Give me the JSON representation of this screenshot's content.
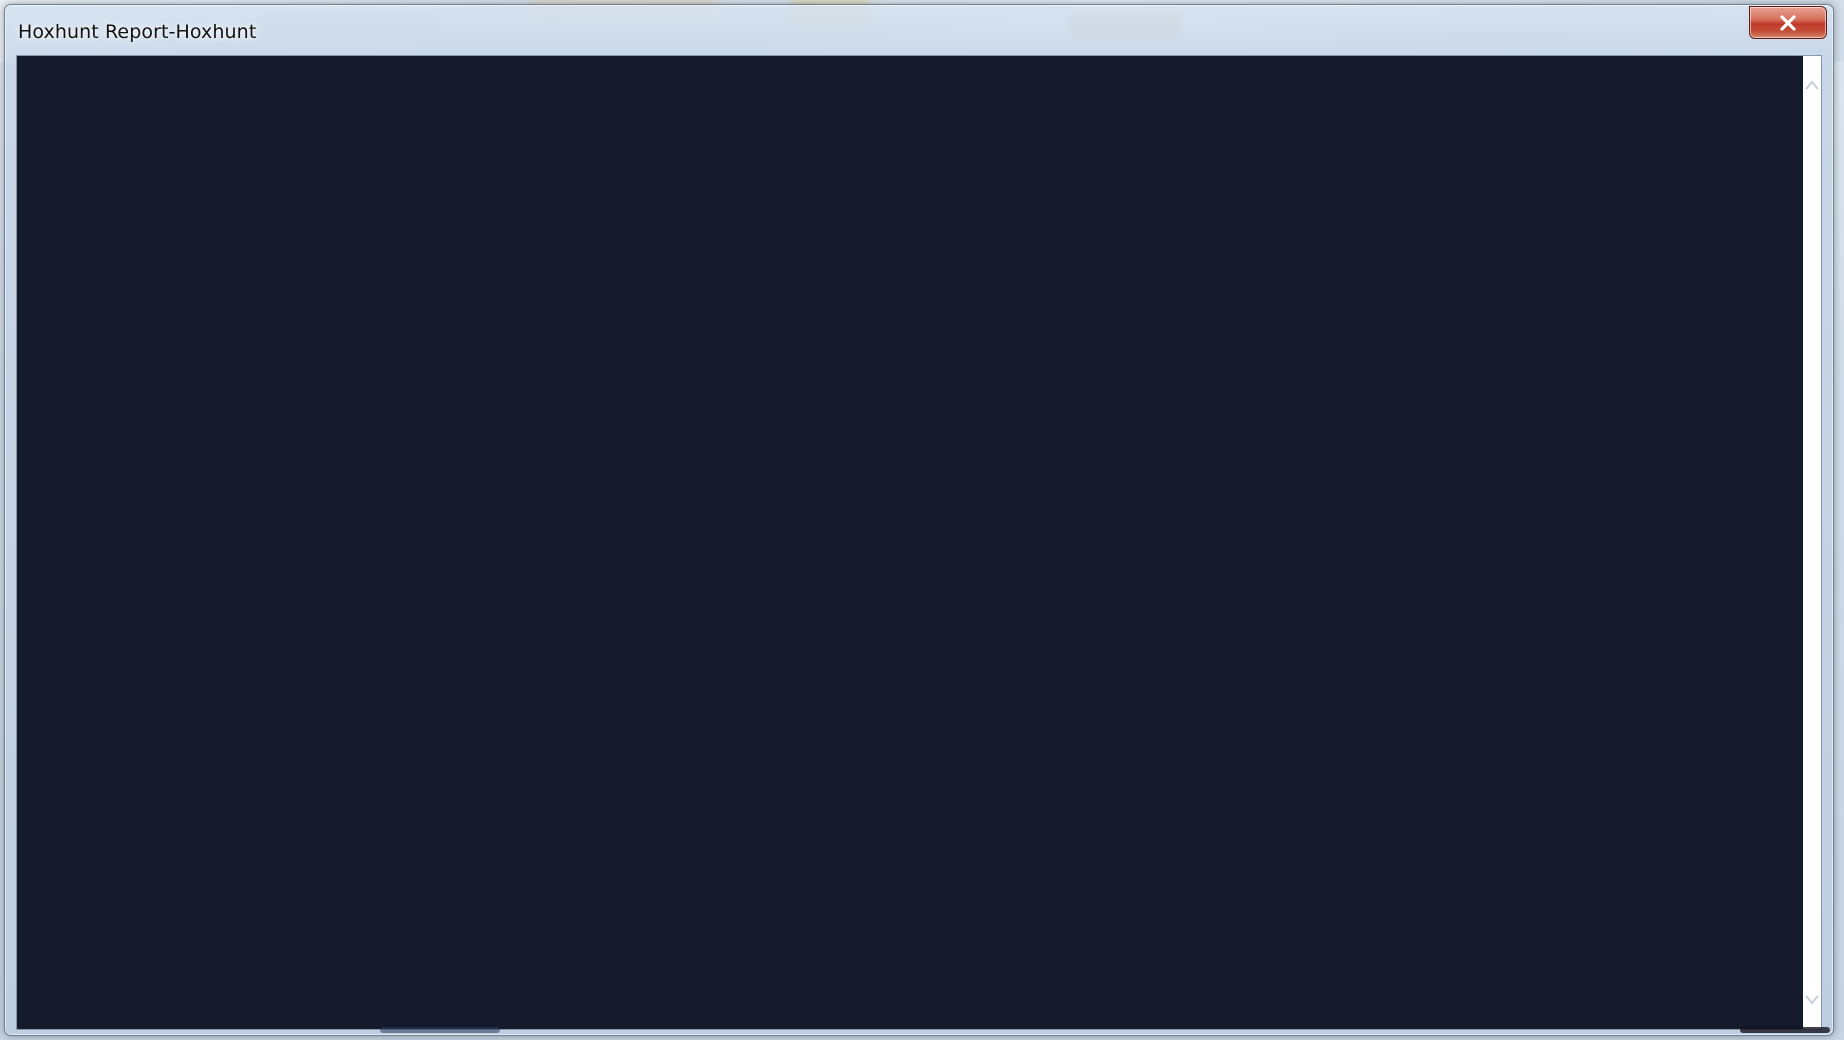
{
  "window": {
    "title": "Hoxhunt Report-Hoxhunt",
    "close_label": "Close"
  },
  "content": {
    "background_color": "#14192b"
  },
  "scrollbar": {
    "up_icon": "chevron-up-icon",
    "down_icon": "chevron-down-icon"
  },
  "colors": {
    "close_button": "#c0392b",
    "content_bg": "#14192b"
  }
}
